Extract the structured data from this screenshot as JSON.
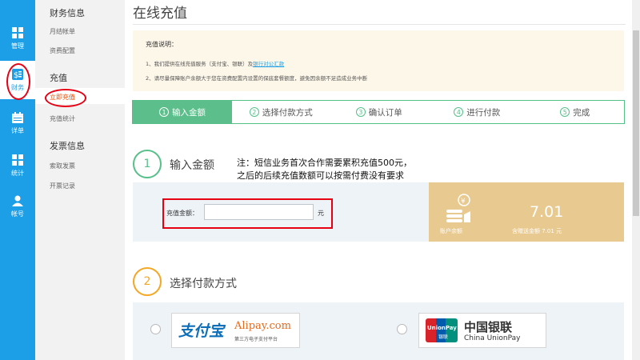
{
  "rail": [
    {
      "label": "管理",
      "icon": "grid-icon"
    },
    {
      "label": "财务",
      "icon": "money-icon",
      "active": true
    },
    {
      "label": "详单",
      "icon": "calendar-icon"
    },
    {
      "label": "统计",
      "icon": "grid-icon"
    },
    {
      "label": "帐号",
      "icon": "user-icon"
    }
  ],
  "subnav": {
    "group1": "财务信息",
    "group1_items": [
      "月结帐单",
      "资费配置"
    ],
    "group2": "充值",
    "group2_items": [
      "立即充值",
      "充值统计"
    ],
    "group3": "发票信息",
    "group3_items": [
      "索取发票",
      "开票记录"
    ]
  },
  "page_title": "在线充值",
  "notice": {
    "title": "充值说明：",
    "line1_prefix": "1、我们提供在线充值服务（支付宝、银联）及",
    "line1_link": "银行对公汇款",
    "line2": "2、请尽量保障账户余额大于您在资费配置内设置的保底套餐额度，避免因余额不足造成业务中断"
  },
  "steps": [
    {
      "num": "1",
      "label": "输入金额"
    },
    {
      "num": "2",
      "label": "选择付款方式"
    },
    {
      "num": "3",
      "label": "确认订单"
    },
    {
      "num": "4",
      "label": "进行付款"
    },
    {
      "num": "5",
      "label": "完成"
    }
  ],
  "section1": {
    "num": "1",
    "title": "输入金额"
  },
  "note_line1": "注：短信业务首次合作需要累积充值500元，",
  "note_line2": "之后的后续充值数额可以按需付费没有要求",
  "amount": {
    "label": "充值金额：",
    "value": "",
    "placeholder": "",
    "unit": "元"
  },
  "balance": {
    "label": "账户余额",
    "value": "7.01",
    "sub": "含赠送金额 7.01 元"
  },
  "section2": {
    "num": "2",
    "title": "选择付款方式"
  },
  "payment": {
    "alipay_cn": "支付宝",
    "alipay_en": "Alipay.com",
    "alipay_sub": "第三方电子支付平台",
    "unionpay_card": "UnionPay",
    "unionpay_card_cn": "银联",
    "unionpay_cn": "中国银联",
    "unionpay_en": "China UnionPay"
  },
  "colors": {
    "rail": "#1c9fe6",
    "accent_green": "#5cbe8a",
    "balance_bg": "#e8c98f",
    "alert_red": "#e60012"
  }
}
